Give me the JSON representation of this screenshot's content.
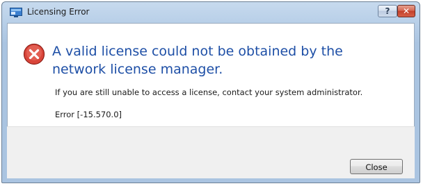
{
  "window": {
    "title": "Licensing Error",
    "icon": "application-window-icon"
  },
  "caption_buttons": {
    "help_label": "?",
    "close_label": "✕"
  },
  "message": {
    "icon": "error-icon",
    "main_instruction": "A valid license could not be obtained by the network license manager.",
    "detail": "If you are still unable to access a license, contact your system administrator.",
    "error_code": "Error [-15.570.0]"
  },
  "footer": {
    "close_button_label": "Close"
  },
  "colors": {
    "instruction_text": "#1e4fa6",
    "error_red": "#d9453a",
    "titlebar": "#b8cfe8"
  }
}
